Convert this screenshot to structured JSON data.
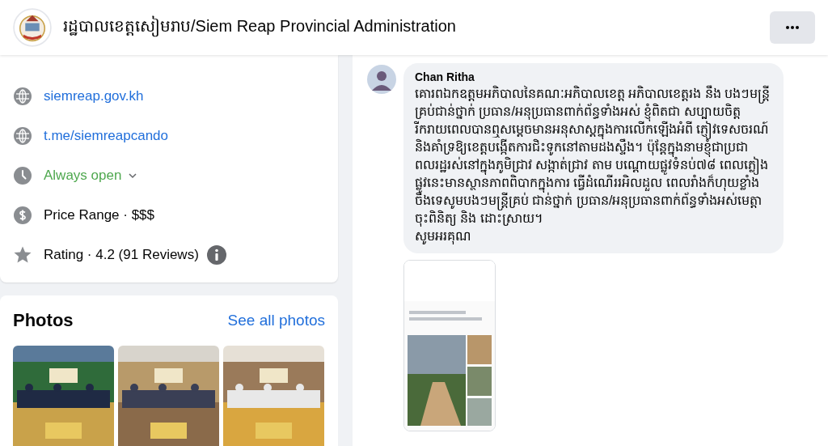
{
  "header": {
    "page_name": "រដ្ឋបាលខេត្តសៀមរាប/Siem Reap Provincial Administration"
  },
  "about_items": [
    {
      "kind": "link",
      "text": "siemreap.gov.kh"
    },
    {
      "kind": "link",
      "text": "t.me/siemreapcando"
    },
    {
      "kind": "hours",
      "text": "Always open"
    },
    {
      "kind": "price",
      "text": "Price Range · $$$"
    },
    {
      "kind": "rating",
      "text": "Rating · 4.2 (91 Reviews)"
    }
  ],
  "photos": {
    "title": "Photos",
    "see_all": "See all photos"
  },
  "comment": {
    "author": "Chan Ritha",
    "body": "គោរពឯកឧត្តមអភិបាលនៃគណៈអភិបាលខេត្ត អភិបាលខេត្តរង នឹង បងៗមន្ត្រីគ្រប់ជាន់ថ្នាក់ ប្រធាន/អនុប្រធានពាក់ព័ន្ធទាំងអស់ ខ្ញុំពិតជា សប្បាយចិត្តរីករាយពេលបានឮសម្តេចមានអនុសាស្តក្នុងការលើកឡើងអំពី ភ្ញៀវទេសចរណ៍ និងគាំទ្រឱ្យខេត្តបង្កើតការជិះទូកនៅតាមដងស្ទឹង។ ប៉ុន្តែក្នុងនាមខ្ញុំជាប្រជាពលរដ្ឋរស់នៅក្នុងភូមិជ្រាវ សង្កាត់ជ្រាវ តាម បណ្តោយផ្លូវទំនប់៧៨ ពេលភ្លៀងផ្លូវនេះមានស្ថានភាពពិបាកក្នុងការ ធ្វើដំណើររអិលដួល ពេលរាំងក៏ហុយខ្លាំង ចឹងទេសូមបងៗមន្ត្រីគ្រប់ ជាន់ថ្នាក់ ប្រធាន/អនុប្រធានពាក់ព័ន្ធទាំងអស់មេត្តាចុះពិនិត្យ និង ដោះស្រាយ។\nសូមអរគុណ"
  }
}
